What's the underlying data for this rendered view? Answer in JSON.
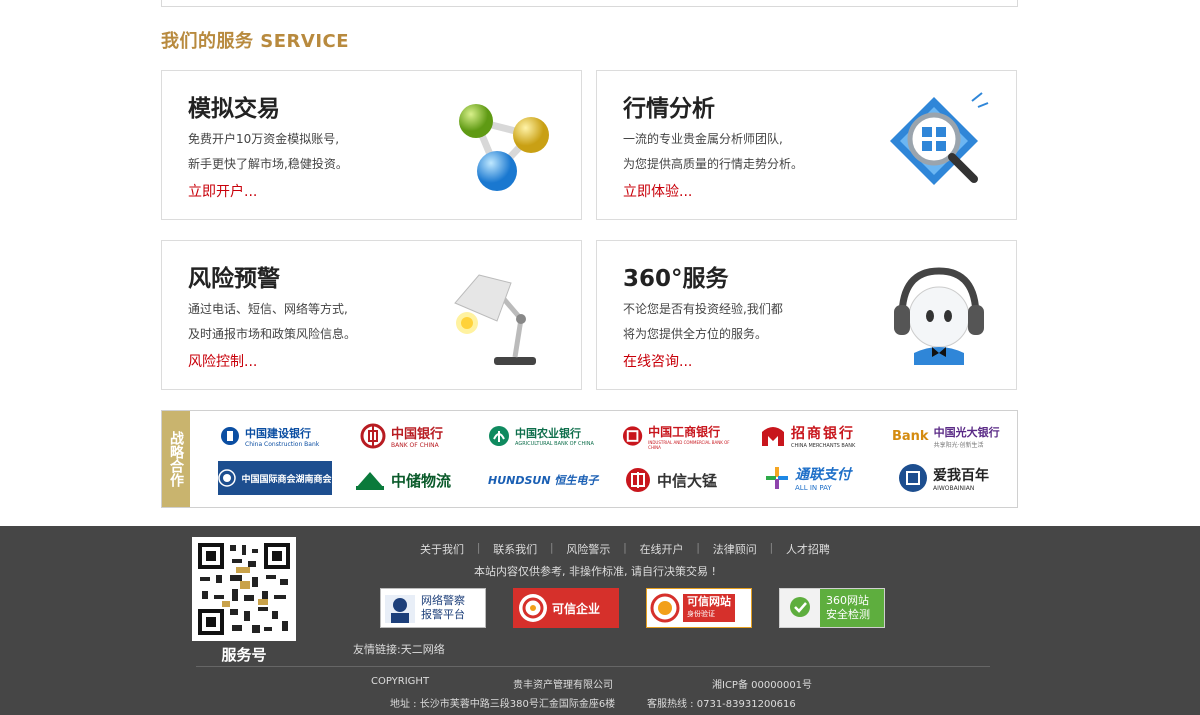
{
  "section": {
    "title": "我们的服务 SERVICE"
  },
  "cards": [
    {
      "title": "模拟交易",
      "line1": "免费开户10万资金模拟账号,",
      "line2": "新手更快了解市场,稳健投资。",
      "link": "立即开户..."
    },
    {
      "title": "行情分析",
      "line1": "一流的专业贵金属分析师团队,",
      "line2": "为您提供高质量的行情走势分析。",
      "link": "立即体验..."
    },
    {
      "title": "风险预警",
      "line1": "通过电话、短信、网络等方式,",
      "line2": "及时通报市场和政策风险信息。",
      "link": "风险控制..."
    },
    {
      "title": "360°服务",
      "line1": "不论您是否有投资经验,我们都",
      "line2": "将为您提供全方位的服务。",
      "link": "在线咨询..."
    }
  ],
  "partners": {
    "label": "战略合作",
    "logos": [
      {
        "name": "中国建设银行",
        "sub": "China Construction Bank"
      },
      {
        "name": "中国银行",
        "sub": "BANK OF CHINA"
      },
      {
        "name": "中国农业银行",
        "sub": "AGRICULTURAL BANK OF CHINA"
      },
      {
        "name": "中国工商银行",
        "sub": "INDUSTRIAL AND COMMERCIAL BANK OF CHINA"
      },
      {
        "name": "招商银行",
        "sub": "CHINA MERCHANTS BANK"
      },
      {
        "name": "中国光大银行",
        "sub": "共享阳光·创新生活"
      },
      {
        "name": "中国国际商会湖南商会",
        "sub": ""
      },
      {
        "name": "中储物流",
        "sub": ""
      },
      {
        "name": "HUNDSUN 恒生电子",
        "sub": ""
      },
      {
        "name": "中信大锰",
        "sub": ""
      },
      {
        "name": "通联支付",
        "sub": "ALL IN PAY"
      },
      {
        "name": "爱我百年",
        "sub": "AIWOBAINIAN"
      }
    ]
  },
  "footer": {
    "qr_caption": "服务号",
    "nav": [
      "关于我们",
      "联系我们",
      "风险警示",
      "在线开户",
      "法律顾问",
      "人才招聘"
    ],
    "separator": "|",
    "note": "本站内容仅供参考, 非操作标准, 请自行决策交易 !",
    "badges": [
      {
        "line1": "网络警察",
        "line2": "报警平台"
      },
      {
        "line1": "可信企业",
        "line2": ""
      },
      {
        "line1": "可信网站",
        "line2": "身份验证"
      },
      {
        "line1": "360网站",
        "line2": "安全检测"
      }
    ],
    "friend_links": "友情链接:天二网络",
    "copyright": "COPYRIGHT",
    "company": "贵丰资产管理有限公司",
    "icp": "湘ICP备 00000001号",
    "address": "地址 : 长沙市芙蓉中路三段380号汇金国际金座6楼",
    "hotline": "客服热线 : 0731-83931200616"
  },
  "colors": {
    "accent": "#b88a3e",
    "link": "#c8000a",
    "footer_bg": "#464646",
    "partner_label": "#c9b46e"
  }
}
